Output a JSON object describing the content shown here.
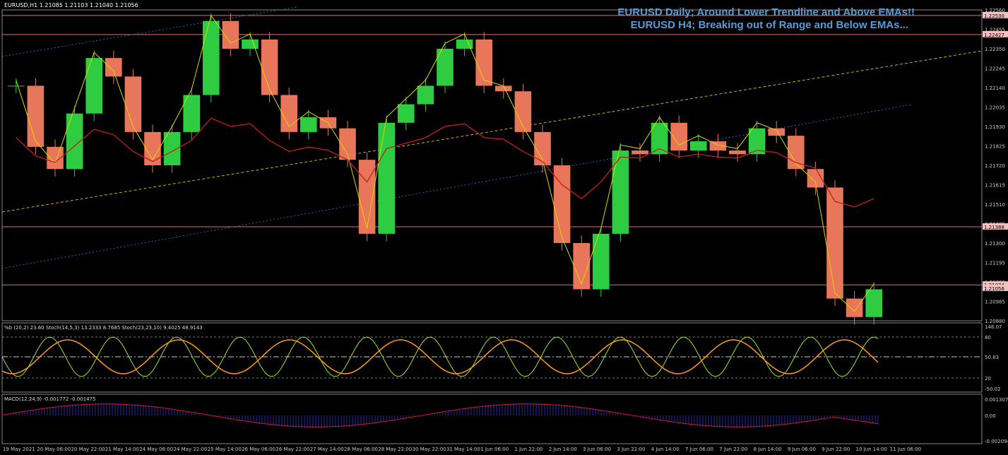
{
  "header": {
    "symbol": "EURUSD,H1 1.21085 1.21103 1.21040 1.21056"
  },
  "annotations": [
    "EURUSD Daily; Around Lower Trendline and Above EMAs!!",
    "EURUSD H4; Breaking out of Range and Below EMAs..."
  ],
  "chart_data": {
    "type": "line",
    "title": "",
    "price_ticks": [
      "1.22560",
      "1.22455",
      "1.22350",
      "1.22245",
      "1.22140",
      "1.22035",
      "1.21930",
      "1.21825",
      "1.21720",
      "1.21615",
      "1.21510",
      "1.21405",
      "1.21300",
      "1.21195",
      "1.21090",
      "1.20985",
      "1.20880"
    ],
    "price_boxes": [
      "1.22530",
      "1.22427",
      "1.21388",
      "1.21074",
      "1.21056"
    ],
    "x_ticks": [
      "19 May 2021",
      "20 May 06:00",
      "20 May 22:00",
      "21 May 14:00",
      "24 May 06:00",
      "24 May 22:00",
      "25 May 14:00",
      "26 May 06:00",
      "26 May 22:00",
      "27 May 14:00",
      "28 May 06:00",
      "28 May 22:00",
      "30 May 22:00",
      "31 May 14:00",
      "1 Jun 06:00",
      "1 Jun 22:00",
      "2 Jun 14:00",
      "3 Jun 06:00",
      "3 Jun 22:00",
      "4 Jun 14:00",
      "7 Jun 06:00",
      "7 Jun 22:00",
      "8 Jun 14:00",
      "9 Jun 06:00",
      "9 Jun 22:00",
      "10 Jun 14:00",
      "11 Jun 06:00"
    ],
    "close": [
      1.2215,
      1.2182,
      1.217,
      1.22,
      1.223,
      1.222,
      1.219,
      1.2172,
      1.219,
      1.221,
      1.225,
      1.2235,
      1.224,
      1.221,
      1.219,
      1.2198,
      1.2192,
      1.2175,
      1.2135,
      1.2195,
      1.2205,
      1.2215,
      1.2235,
      1.224,
      1.2215,
      1.2212,
      1.219,
      1.2172,
      1.213,
      1.2105,
      1.2135,
      1.218,
      1.2178,
      1.2195,
      1.218,
      1.2185,
      1.218,
      1.2178,
      1.2192,
      1.2188,
      1.217,
      1.216,
      1.21,
      1.209,
      1.2105
    ],
    "osc_ticks": [
      "148.07",
      "80",
      "50.83",
      "20",
      "-50.02"
    ],
    "osc_label": "%b (20,2) 23.60  Stoch(14,5,3) 13.2333 8.7685  Stoch(23,23,10) 9.4025 48.9143",
    "macd_ticks": [
      "0.001307",
      "0.00",
      "-0.002094"
    ],
    "macd_label": "MACD(12,24,9) -0.001772 -0.001475"
  }
}
